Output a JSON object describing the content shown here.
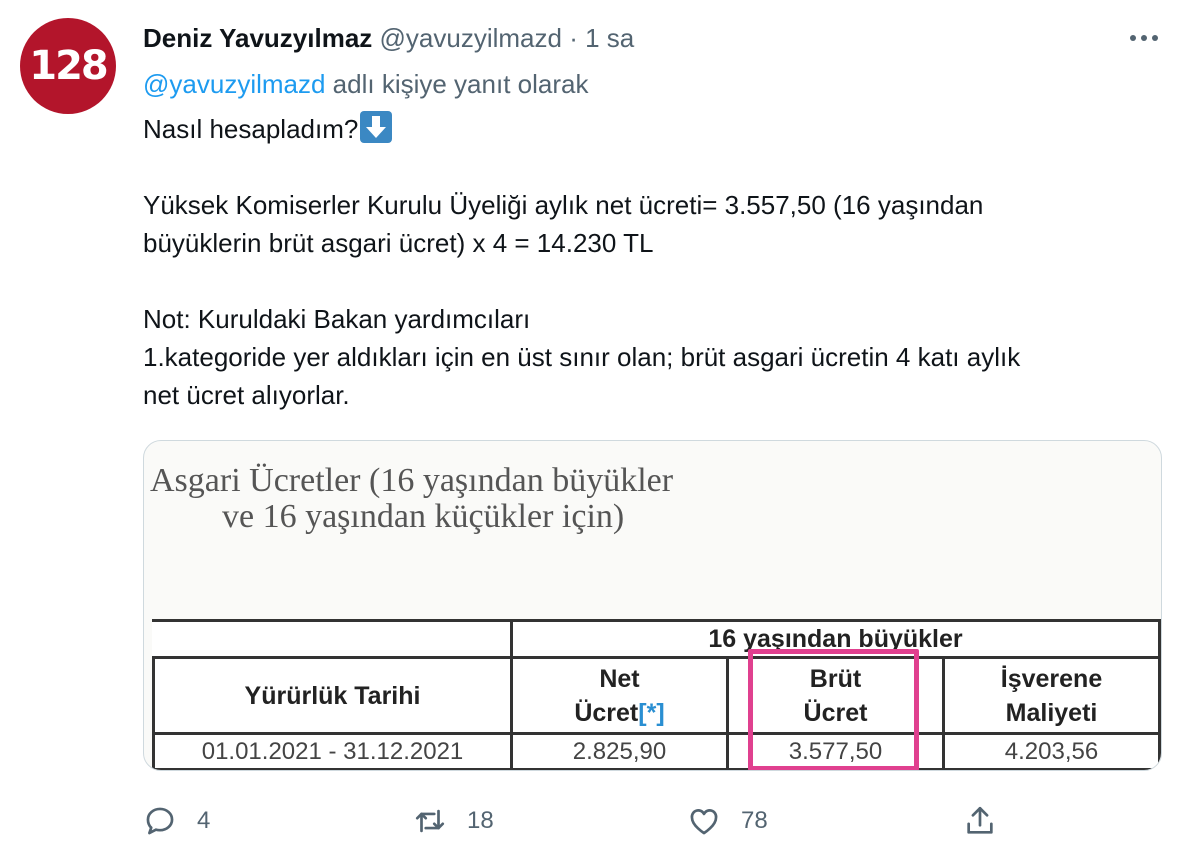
{
  "author": {
    "avatar_text": "128",
    "display_name": "Deniz Yavuzyılmaz",
    "handle": "@yavuzyilmazd",
    "separator": "·",
    "time": "1 sa"
  },
  "reply_to": {
    "mention": "@yavuzyilmazd",
    "suffix": " adlı kişiye yanıt olarak"
  },
  "tweet": {
    "line1": "Nasıl hesapladım?",
    "line1_emoji": "down-arrow-emoji",
    "paragraph2": "Yüksek Komiserler Kurulu Üyeliği aylık net ücreti= 3.557,50 (16 yaşından\nbüyüklerin brüt asgari ücret) x 4 = 14.230 TL",
    "paragraph3": "Not: Kuruldaki Bakan yardımcıları\n1.kategoride yer aldıkları için en üst sınır olan; brüt asgari ücretin 4 katı aylık\nnet ücret alıyorlar."
  },
  "media": {
    "title_line1": "Asgari Ücretler (16 yaşından büyükler",
    "title_line2": "ve 16 yaşından küçükler için)",
    "table": {
      "group_header": "16 yaşından büyükler",
      "col_date": "Yürürlük Tarihi",
      "col_net_line1": "Net",
      "col_net_line2": "Ücret",
      "col_net_note": "[*]",
      "col_brut_line1": "Brüt",
      "col_brut_line2": "Ücret",
      "col_isv_line1": "İşverene",
      "col_isv_line2": "Maliyeti",
      "row": {
        "date": "01.01.2021 - 31.12.2021",
        "net": "2.825,90",
        "brut": "3.577,50",
        "isv": "4.203,56"
      }
    },
    "highlight_color": "#e0408f"
  },
  "actions": {
    "reply_count": "4",
    "retweet_count": "18",
    "like_count": "78"
  },
  "colors": {
    "avatar_bg": "#b3152b",
    "link": "#1d9bf0",
    "secondary_text": "#536471"
  }
}
